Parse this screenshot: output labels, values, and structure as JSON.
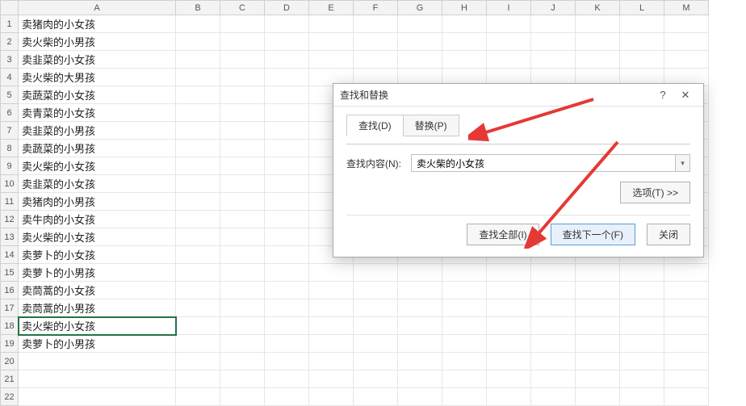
{
  "columns": [
    "A",
    "B",
    "C",
    "D",
    "E",
    "F",
    "G",
    "H",
    "I",
    "J",
    "K",
    "L",
    "M"
  ],
  "rows": [
    "卖猪肉的小女孩",
    "卖火柴的小男孩",
    "卖韭菜的小女孩",
    "卖火柴的大男孩",
    "卖蔬菜的小女孩",
    "卖青菜的小女孩",
    "卖韭菜的小男孩",
    "卖蔬菜的小男孩",
    "卖火柴的小女孩",
    "卖韭菜的小女孩",
    "卖猪肉的小男孩",
    "卖牛肉的小女孩",
    "卖火柴的小女孩",
    "卖萝卜的小女孩",
    "卖萝卜的小男孩",
    "卖茼蒿的小女孩",
    "卖茼蒿的小男孩",
    "卖火柴的小女孩",
    "卖萝卜的小男孩",
    "",
    "",
    ""
  ],
  "selected_row_index": 17,
  "dialog": {
    "title": "查找和替换",
    "help_glyph": "?",
    "close_glyph": "✕",
    "tabs": {
      "find": "查找(D)",
      "replace": "替换(P)"
    },
    "find_label": "查找内容(N):",
    "find_value": "卖火柴的小女孩",
    "options_btn": "选项(T) >>",
    "find_all_btn": "查找全部(I)",
    "find_next_btn": "查找下一个(F)",
    "close_btn": "关闭"
  }
}
